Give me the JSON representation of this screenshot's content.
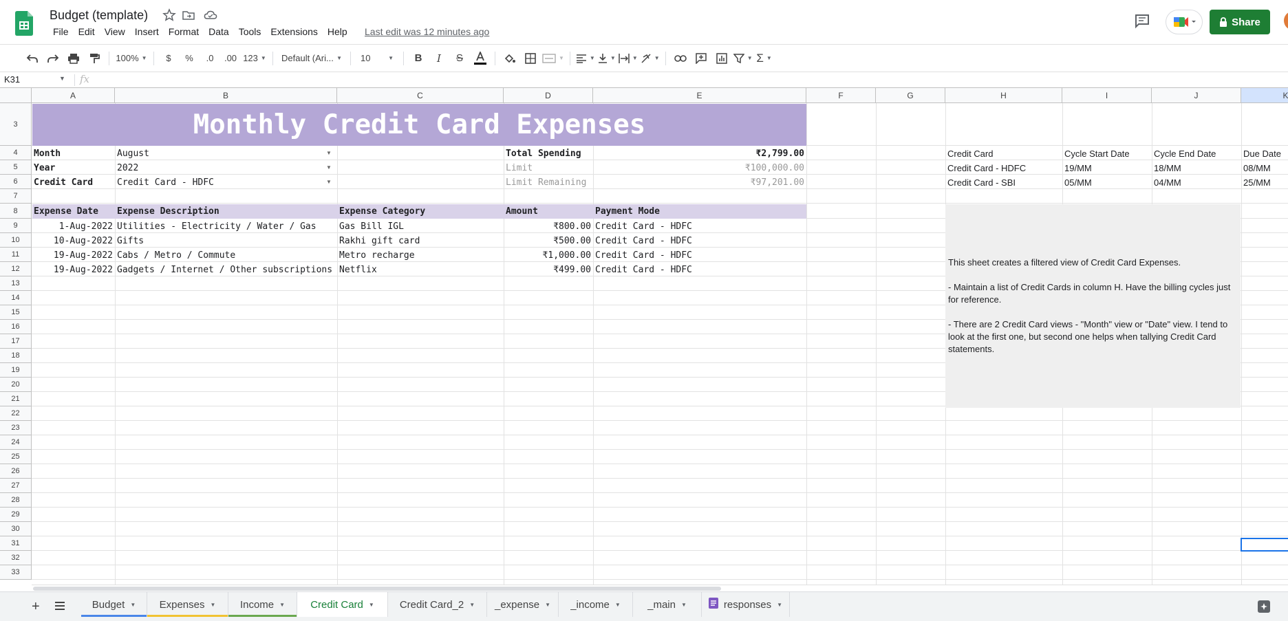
{
  "app": {
    "doc_title": "Budget (template)",
    "menu": [
      "File",
      "Edit",
      "View",
      "Insert",
      "Format",
      "Data",
      "Tools",
      "Extensions",
      "Help"
    ],
    "last_edit": "Last edit was 12 minutes ago",
    "share_label": "Share",
    "accent": "#1e7e34"
  },
  "toolbar": {
    "zoom": "100%",
    "currency": "$",
    "percent": "%",
    "dec_less": ".0",
    "dec_more": ".00",
    "format_more": "123",
    "font": "Default (Ari...",
    "font_size": "10"
  },
  "formula_bar": {
    "cell_ref": "K31",
    "fx_label": "fx",
    "value": ""
  },
  "columns": [
    "A",
    "B",
    "C",
    "D",
    "E",
    "F",
    "G",
    "H",
    "I",
    "J",
    "K"
  ],
  "rows": [
    "3",
    "4",
    "5",
    "6",
    "7",
    "8",
    "9",
    "10",
    "11",
    "12",
    "13",
    "14",
    "15",
    "16",
    "17",
    "18",
    "19",
    "20",
    "21",
    "22",
    "23",
    "24",
    "25",
    "26",
    "27",
    "28",
    "29",
    "30",
    "31",
    "32",
    "33"
  ],
  "sheet": {
    "banner": "Monthly Credit Card Expenses",
    "filters": {
      "month_label": "Month",
      "month_value": "August",
      "year_label": "Year",
      "year_value": "2022",
      "card_label": "Credit Card",
      "card_value": "Credit Card - HDFC"
    },
    "summary": {
      "total_label": "Total Spending",
      "total_value": "₹2,799.00",
      "limit_label": "Limit",
      "limit_value": "₹100,000.00",
      "remaining_label": "Limit Remaining",
      "remaining_value": "₹97,201.00"
    },
    "table_headers": [
      "Expense Date",
      "Expense Description",
      "Expense Category",
      "Amount",
      "Payment Mode"
    ],
    "expenses": [
      [
        "1-Aug-2022",
        "Utilities - Electricity / Water / Gas",
        "Gas Bill IGL",
        "₹800.00",
        "Credit Card - HDFC"
      ],
      [
        "10-Aug-2022",
        "Gifts",
        "Rakhi gift card",
        "₹500.00",
        "Credit Card - HDFC"
      ],
      [
        "19-Aug-2022",
        "Cabs / Metro / Commute",
        "Metro recharge",
        "₹1,000.00",
        "Credit Card - HDFC"
      ],
      [
        "19-Aug-2022",
        "Gadgets / Internet / Other subscriptions",
        "Netflix",
        "₹499.00",
        "Credit Card - HDFC"
      ]
    ],
    "cards_table": {
      "headers": [
        "Credit Card",
        "Cycle Start Date",
        "Cycle End Date",
        "Due Date"
      ],
      "rows": [
        [
          "Credit Card - HDFC",
          "19/MM",
          "18/MM",
          "08/MM"
        ],
        [
          "Credit Card - SBI",
          "05/MM",
          "04/MM",
          "25/MM"
        ]
      ]
    },
    "note": {
      "p1": "This sheet creates a filtered view of Credit Card Expenses.",
      "p2": "- Maintain a list of Credit Cards in column H. Have the billing cycles just for reference.",
      "p3": "- There are 2 Credit Card views - \"Month\" view or \"Date\" view. I tend to look at the first one, but second one helps when tallying Credit Card statements."
    }
  },
  "tabs": [
    {
      "label": "Budget",
      "color": "#4a86e8"
    },
    {
      "label": "Expenses",
      "color": "#f1c232"
    },
    {
      "label": "Income",
      "color": "#6aa84f"
    },
    {
      "label": "Credit Card",
      "color": ""
    },
    {
      "label": "Credit Card_2",
      "color": ""
    },
    {
      "label": "_expense",
      "color": ""
    },
    {
      "label": "_income",
      "color": ""
    },
    {
      "label": "_main",
      "color": ""
    },
    {
      "label": "responses",
      "color": ""
    }
  ],
  "active_tab": "Credit Card"
}
